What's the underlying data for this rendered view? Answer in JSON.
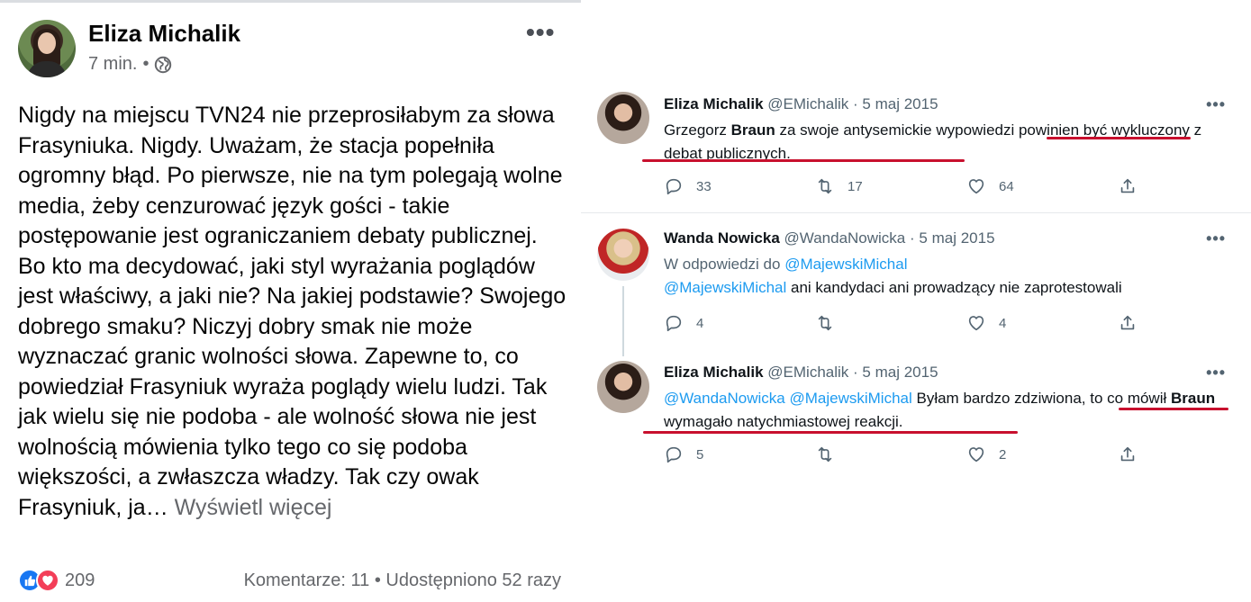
{
  "facebook": {
    "author": "Eliza Michalik",
    "time": "7 min.",
    "separator": "•",
    "more_glyph": "•••",
    "text": "Nigdy na miejscu TVN24 nie przeprosiłabym za słowa Frasyniuka. Nigdy. Uważam, że stacja popełniła ogromny błąd. Po pierwsze, nie na tym polegają wolne media, żeby cenzurować język gości - takie postępowanie jest ograniczaniem debaty publicznej. Bo kto ma decydować, jaki styl wyrażania poglądów jest właściwy, a jaki nie? Na jakiej podstawie? Swojego dobrego smaku? Niczyj dobry smak nie może wyznaczać granic wolności słowa. Zapewne to, co powiedział Frasyniuk wyraża poglądy wielu ludzi. Tak jak wielu się nie podoba - ale wolność słowa nie jest wolnością mówienia tylko tego co się podoba większości, a zwłaszcza władzy. Tak czy owak Frasyniuk, ja…",
    "see_more": "Wyświetl więcej",
    "reactions_count": "209",
    "comments": "Komentarze: 11",
    "stats_separator": "•",
    "shares": "Udostępniono 52 razy",
    "icons": {
      "like": "thumbs-up-icon",
      "love": "heart-icon",
      "privacy": "globe-icon",
      "menu": "more-horizontal-icon"
    }
  },
  "twitter": {
    "tweets": [
      {
        "name": "Eliza Michalik",
        "handle": "@EMichalik",
        "dot": "·",
        "date": "5 maj 2015",
        "text_a": "Grzegorz ",
        "text_bold": "Braun",
        "text_b": " za swoje antysemickie wypowiedzi powinien być wykluczony z debat publicznych.",
        "replies": "33",
        "retweets": "17",
        "likes": "64"
      },
      {
        "name": "Wanda Nowicka",
        "handle": "@WandaNowicka",
        "dot": "·",
        "date": "5 maj 2015",
        "reply_to_label": "W odpowiedzi do ",
        "reply_to_handle": "@MajewskiMichal",
        "mention": "@MajewskiMichal",
        "text": " ani kandydaci ani prowadzący nie zaprotestowali",
        "replies": "4",
        "retweets": "",
        "likes": "4"
      },
      {
        "name": "Eliza Michalik",
        "handle": "@EMichalik",
        "dot": "·",
        "date": "5 maj 2015",
        "mention1": "@WandaNowicka",
        "mention2": "@MajewskiMichal",
        "text_a": " Byłam bardzo zdziwiona, to co mówił ",
        "text_bold": "Braun",
        "text_b": " wymagało natychmiastowej reakcji.",
        "replies": "5",
        "retweets": "",
        "likes": "2"
      }
    ],
    "more_glyph": "•••",
    "icons": {
      "reply": "reply-icon",
      "retweet": "retweet-icon",
      "like": "heart-outline-icon",
      "share": "share-icon"
    },
    "highlight_color": "#c8102e",
    "link_color": "#1d9bf0"
  }
}
